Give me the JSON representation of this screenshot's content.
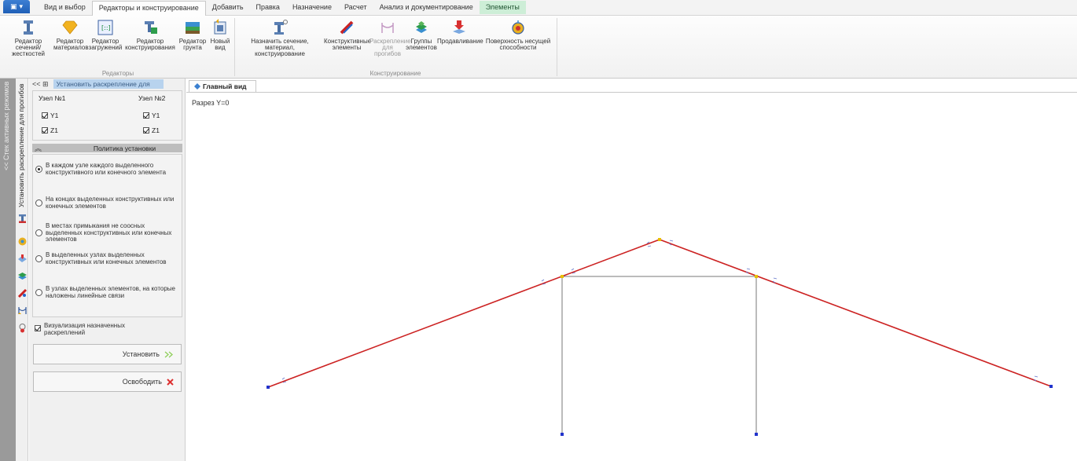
{
  "tabs": {
    "view": "Вид и выбор",
    "editors": "Редакторы и конструирование",
    "add": "Добавить",
    "edit": "Правка",
    "assign": "Назначение",
    "calc": "Расчет",
    "analysis": "Анализ и документирование",
    "elements": "Элементы"
  },
  "ribbon": {
    "sections_1": "Редактор сечений/",
    "sections_2": "жесткостей",
    "materials_1": "Редактор",
    "materials_2": "материалов",
    "loads_1": "Редактор",
    "loads_2": "загружений",
    "design_1": "Редактор",
    "design_2": "конструирования",
    "soil_1": "Редактор",
    "soil_2": "грунта",
    "newview_1": "Новый",
    "newview_2": "вид",
    "group_editors": "Редакторы",
    "assign_1": "Назначить сечение, материал,",
    "assign_2": "конструирование",
    "struct_1": "Конструктивные",
    "struct_2": "элементы",
    "bracing_1": "Раскрепление",
    "bracing_2": "для прогибов",
    "groups_1": "Группы",
    "groups_2": "элементов",
    "punch": "Продавливание",
    "surface_1": "Поверхность несущей",
    "surface_2": "способности",
    "group_design": "Конструирование"
  },
  "side": {
    "stack": "<< Стек активных режимов",
    "mode": "Установить раскрепление для прогибов"
  },
  "panel": {
    "title_buttons": "<<  ⊞",
    "title": "Установить раскрепление для",
    "node1": "Узел №1",
    "node2": "Узел №2",
    "y1": "Y1",
    "z1": "Z1",
    "policy": "Политика установки",
    "opt1": "В каждом узле каждого выделенного конструктивного или конечного элемента",
    "opt2": "На концах выделенных конструктивных или конечных элементов",
    "opt3": "В местах примыкания не соосных выделенных конструктивных или конечных элементов",
    "opt4": "В выделенных узлах выделенных конструктивных или конечных элементов",
    "opt5": "В узлах выделенных элементов, на которые наложены линейные связи",
    "visualize": "Визуализация назначенных раскреплений",
    "set": "Установить",
    "release": "Освободить"
  },
  "viewport": {
    "tab": "Главный вид",
    "section": "Разрез Y=0"
  },
  "colors": {
    "member_red": "#cc2222",
    "member_gray": "#777777",
    "node_blue": "#2233cc",
    "node_yellow": "#e8c000"
  }
}
